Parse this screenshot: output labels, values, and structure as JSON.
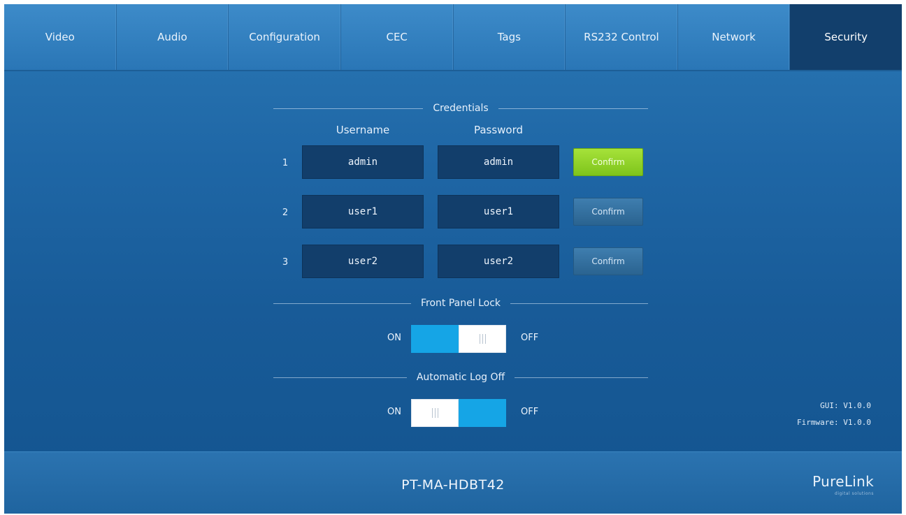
{
  "nav": {
    "tabs": [
      {
        "label": "Video"
      },
      {
        "label": "Audio"
      },
      {
        "label": "Configuration"
      },
      {
        "label": "CEC"
      },
      {
        "label": "Tags"
      },
      {
        "label": "RS232 Control"
      },
      {
        "label": "Network"
      },
      {
        "label": "Security"
      }
    ],
    "active": "Security"
  },
  "credentials": {
    "title": "Credentials",
    "username_header": "Username",
    "password_header": "Password",
    "rows": [
      {
        "index": "1",
        "username": "admin",
        "password": "admin",
        "confirm_label": "Confirm",
        "confirm_style": "active-green"
      },
      {
        "index": "2",
        "username": "user1",
        "password": "user1",
        "confirm_label": "Confirm",
        "confirm_style": "default"
      },
      {
        "index": "3",
        "username": "user2",
        "password": "user2",
        "confirm_label": "Confirm",
        "confirm_style": "default"
      }
    ]
  },
  "front_panel_lock": {
    "title": "Front Panel Lock",
    "on_label": "ON",
    "off_label": "OFF",
    "state": "ON"
  },
  "automatic_log_off": {
    "title": "Automatic Log Off",
    "on_label": "ON",
    "off_label": "OFF",
    "state": "OFF"
  },
  "version": {
    "gui": "GUI: V1.0.0",
    "firmware": "Firmware: V1.0.0"
  },
  "footer": {
    "model": "PT-MA-HDBT42",
    "brand": "PureLink",
    "brand_tagline": "digital solutions"
  },
  "colors": {
    "confirm_active": "#8fd22a",
    "toggle_on": "#15a5e6",
    "active_tab": "#123f6c"
  }
}
